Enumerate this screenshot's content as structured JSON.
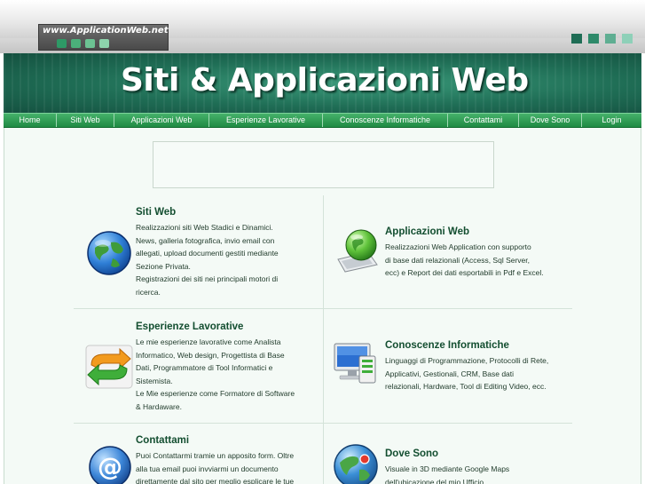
{
  "site": {
    "logo_text": "www.ApplicationWeb.net",
    "banner_title": "Siti & Applicazioni Web"
  },
  "corner_squares": [
    "#1f6d55",
    "#2e8a6a",
    "#5fae92",
    "#8ed0b8"
  ],
  "nav": [
    {
      "label": "Home"
    },
    {
      "label": "Siti Web"
    },
    {
      "label": "Applicazioni Web"
    },
    {
      "label": "Esperienze Lavorative"
    },
    {
      "label": "Conoscenze Informatiche"
    },
    {
      "label": "Contattami"
    },
    {
      "label": "Dove Sono"
    },
    {
      "label": "Login"
    }
  ],
  "sections": [
    {
      "id": "siti-web",
      "title": "Siti Web",
      "icon": "globe-icon",
      "lines": [
        "Realizzazioni siti Web Stadici e Dinamici.",
        "News, galleria fotografica, invio email con",
        "allegati, upload documenti gestiti mediante",
        "Sezione Privata.",
        "Registrazioni dei siti nei principali motori di",
        "ricerca."
      ]
    },
    {
      "id": "applicazioni-web",
      "title": "Applicazioni Web",
      "icon": "globe-laptop-icon",
      "lines": [
        "Realizzazioni Web Application con supporto",
        "di base dati relazionali (Access, Sql Server,",
        "ecc) e Report dei dati esportabili in Pdf e Excel."
      ]
    },
    {
      "id": "esperienze-lavorative",
      "title": "Esperienze Lavorative",
      "icon": "sync-arrows-icon",
      "lines": [
        "Le mie esperienze lavorative come Analista",
        "Informatico, Web design, Progettista di Base",
        "Dati, Programmatore di Tool Informatici e",
        "Sistemista.",
        "Le Mie esperienze come Formatore di Software",
        "& Hardaware."
      ]
    },
    {
      "id": "conoscenze-informatiche",
      "title": "Conoscenze Informatiche",
      "icon": "computer-icon",
      "lines": [
        "Linguaggi di Programmazione, Protocolli di Rete,",
        "Applicativi, Gestionali, CRM, Base dati",
        "relazionali, Hardware, Tool di Editing Video, ecc."
      ]
    },
    {
      "id": "contattami",
      "title": "Contattami",
      "icon": "email-at-icon",
      "lines": [
        "Puoi Contattarmi tramie un apposito form. Oltre",
        "alla tua email puoi invviarmi un documento",
        "direttamente dal sito per meglio esplicare le tue"
      ]
    },
    {
      "id": "dove-sono",
      "title": "Dove Sono",
      "icon": "map-globe-icon",
      "lines": [
        "Visuale in 3D mediante Google Maps",
        "dell'ubicazione del mio Ufficio"
      ]
    }
  ]
}
